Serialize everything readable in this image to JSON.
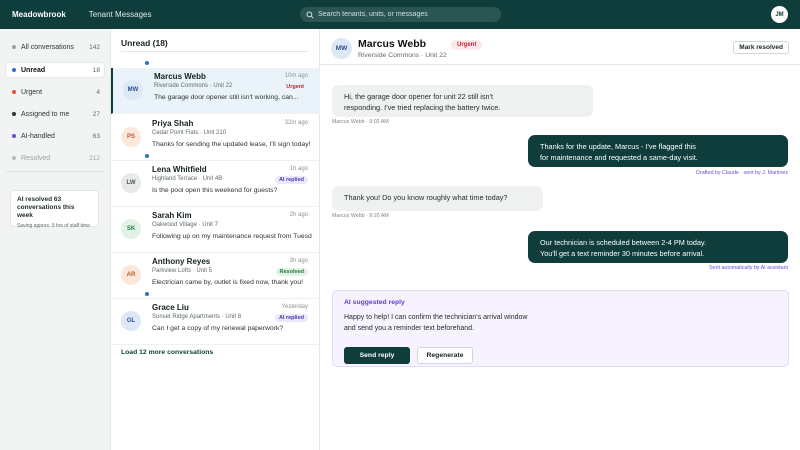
{
  "topbar": {
    "brand": "Meadowbrook",
    "nav_title": "Tenant Messages",
    "search_placeholder": "Search tenants, units, or messages",
    "user_initials": "JM"
  },
  "sidebar": {
    "items": [
      {
        "label": "All conversations",
        "count": "142",
        "color": "#9aa3a2"
      },
      {
        "label": "Unread",
        "count": "18",
        "color": "#2a6fd6"
      },
      {
        "label": "Urgent",
        "count": "4",
        "color": "#e0523c"
      },
      {
        "label": "Assigned to me",
        "count": "27",
        "color": "#2b3534"
      },
      {
        "label": "AI-handled",
        "count": "63",
        "color": "#6c4fd4"
      },
      {
        "label": "Resolved",
        "count": "212",
        "color": "#b6bdbc"
      }
    ],
    "ai_card": {
      "title": "AI resolved 63 conversations this week",
      "subtitle": "Saving approx. 9 hrs of staff time"
    }
  },
  "list": {
    "header": "Unread (18)",
    "load_more": "Load 12 more conversations",
    "conversations": [
      {
        "initials": "MW",
        "name": "Marcus Webb",
        "sub": "Riverside Commons · Unit 22",
        "preview": "The garage door opener still isn't working, can...",
        "time": "10m ago",
        "badge": "Urgent",
        "badge_type": "urgent",
        "avatar_bg": "#dde8f6",
        "avatar_fg": "#2d4f8a"
      },
      {
        "initials": "PS",
        "name": "Priya Shah",
        "sub": "Cedar Point Flats · Unit 210",
        "preview": "Thanks for sending the updated lease, I'll sign today!",
        "time": "32m ago",
        "badge": "",
        "badge_type": "",
        "avatar_bg": "#fbe7dc",
        "avatar_fg": "#b85a2a"
      },
      {
        "initials": "LW",
        "name": "Lena Whitfield",
        "sub": "Highland Terrace · Unit 4B",
        "preview": "Is the pool open this weekend for guests?",
        "time": "1h ago",
        "badge": "AI replied",
        "badge_type": "ai",
        "avatar_bg": "#e7e9ea",
        "avatar_fg": "#4b5556"
      },
      {
        "initials": "SK",
        "name": "Sarah Kim",
        "sub": "Oakwood Village · Unit 7",
        "preview": "Following up on my maintenance request from Tuesday",
        "time": "2h ago",
        "badge": "",
        "badge_type": "",
        "avatar_bg": "#e0f2e6",
        "avatar_fg": "#2c7a45"
      },
      {
        "initials": "AR",
        "name": "Anthony Reyes",
        "sub": "Parkview Lofts · Unit 5",
        "preview": "Electrician came by, outlet is fixed now, thank you!",
        "time": "3h ago",
        "badge": "Resolved",
        "badge_type": "resolved",
        "avatar_bg": "#fbe7dc",
        "avatar_fg": "#b85a2a"
      },
      {
        "initials": "GL",
        "name": "Grace Liu",
        "sub": "Sunset Ridge Apartments · Unit 8",
        "preview": "Can I get a copy of my renewal paperwork?",
        "time": "Yesterday",
        "badge": "AI replied",
        "badge_type": "ai",
        "avatar_bg": "#dde8f6",
        "avatar_fg": "#2d4f8a"
      }
    ]
  },
  "chat": {
    "initials": "MW",
    "name": "Marcus Webb",
    "sub": "Riverside Commons · Unit 22",
    "urgent_label": "Urgent",
    "mark_resolved": "Mark resolved",
    "messages": [
      {
        "line1": "Hi, the garage door opener for unit 22 still isn't",
        "line2": "responding. I've tried replacing the battery twice.",
        "meta": "Marcus Webb · 9:02 AM"
      },
      {
        "line1": "Thanks for the update, Marcus - I've flagged this",
        "line2": "for maintenance and requested a same-day visit.",
        "meta": "Drafted by Claude · sent by J. Martinez"
      },
      {
        "line1": "Thank you! Do you know roughly what time today?",
        "line2": "",
        "meta": "Marcus Webb · 9:20 AM"
      },
      {
        "line1": "Our technician is scheduled between 2-4 PM today.",
        "line2": "You'll get a text reminder 30 minutes before arrival.",
        "meta": "Sent automatically by AI assistant"
      }
    ],
    "suggestion": {
      "header": "AI suggested reply",
      "line1": "Happy to help! I can confirm the technician's arrival window",
      "line2": "and send you a reminder text beforehand.",
      "send": "Send reply",
      "regenerate": "Regenerate"
    }
  }
}
